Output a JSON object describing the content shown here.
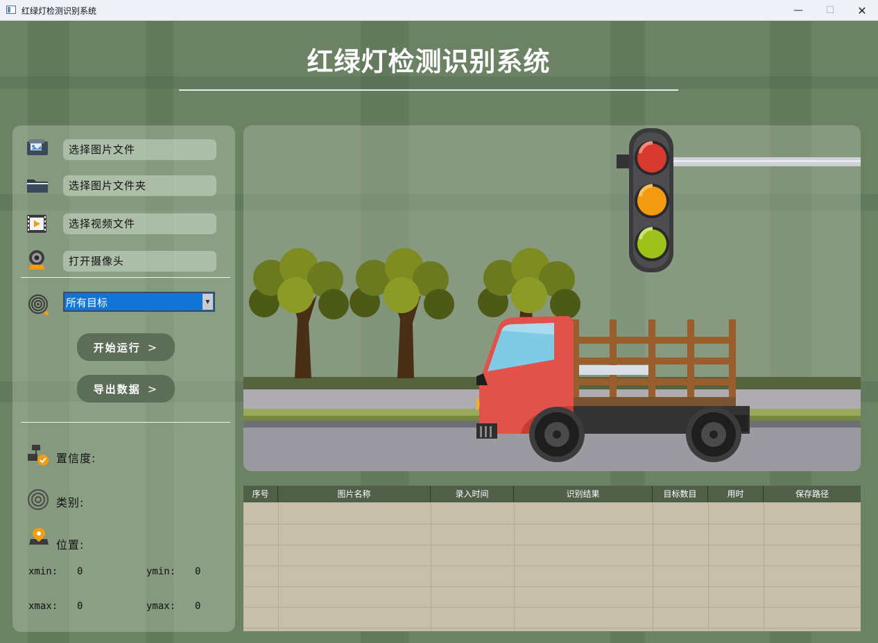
{
  "window": {
    "title": "红绿灯检测识别系统",
    "minimize": "—",
    "maximize": "☐",
    "close": "✕"
  },
  "header": {
    "title": "红绿灯检测识别系统"
  },
  "sidebar": {
    "select_image": "选择图片文件",
    "select_folder": "选择图片文件夹",
    "select_video": "选择视频文件",
    "open_camera": "打开摄像头",
    "target_select": {
      "selected": "所有目标",
      "arrow": "▼"
    },
    "start_button": "开始运行",
    "export_button": "导出数据",
    "chevron": ">",
    "confidence_label": "置信度:",
    "class_label": "类别:",
    "position_label": "位置:",
    "coords": {
      "xmin_label": "xmin:",
      "xmin": "0",
      "ymin_label": "ymin:",
      "ymin": "0",
      "xmax_label": "xmax:",
      "xmax": "0",
      "ymax_label": "ymax:",
      "ymax": "0"
    }
  },
  "table": {
    "columns": [
      "序号",
      "图片名称",
      "录入时间",
      "识别结果",
      "目标数目",
      "用时",
      "保存路径"
    ],
    "rows": []
  },
  "colors": {
    "accent": "#1174d6",
    "button": "#5c6e57",
    "table_header": "#4f5f48",
    "table_body": "#c7bfab"
  }
}
